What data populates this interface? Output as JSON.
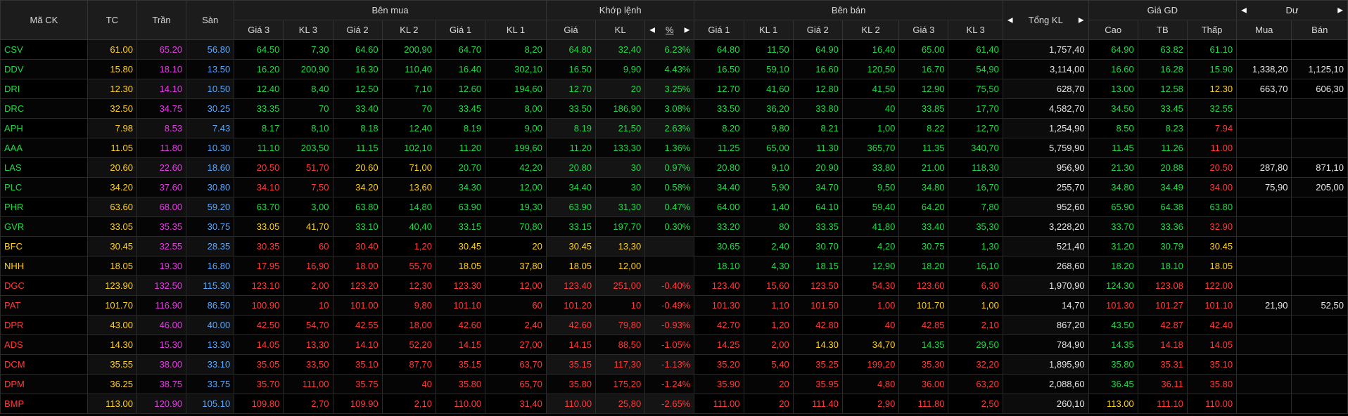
{
  "headers": {
    "symbol": "Mã CK",
    "ref": "TC",
    "ceil": "Trần",
    "floor": "Sàn",
    "buy_group": "Bên mua",
    "match_group": "Khớp lệnh",
    "sell_group": "Bên bán",
    "total": "Tổng KL",
    "price_group": "Giá GD",
    "foreign_group": "Dư",
    "buy_cols": [
      "Giá 3",
      "KL 3",
      "Giá 2",
      "KL 2",
      "Giá 1",
      "KL 1"
    ],
    "match_cols": [
      "Giá",
      "KL",
      "%"
    ],
    "sell_cols": [
      "Giá 1",
      "KL 1",
      "Giá 2",
      "KL 2",
      "Giá 3",
      "KL 3"
    ],
    "price_cols": [
      "Cao",
      "TB",
      "Thấp"
    ],
    "foreign_cols": [
      "Mua",
      "Bán"
    ]
  },
  "colors": {
    "up": "#23d84a",
    "down": "#ff3b3b",
    "ref": "#ffd21f",
    "ceil": "#e63ce6",
    "floor": "#5aa9ff"
  },
  "rows": [
    {
      "sym": "CSV",
      "sc": "up",
      "tc": "61.00",
      "tr": "65.20",
      "sa": "56.80",
      "b3p": "64.50",
      "b3pc": "up",
      "b3v": "7,30",
      "b2p": "64.60",
      "b2pc": "up",
      "b2v": "200,90",
      "b1p": "64.70",
      "b1pc": "up",
      "b1v": "8,20",
      "mp": "64.80",
      "mc": "up",
      "mv": "32,40",
      "pct": "6.23%",
      "s1p": "64.80",
      "s1pc": "up",
      "s1v": "11,50",
      "s2p": "64.90",
      "s2pc": "up",
      "s2v": "16,40",
      "s3p": "65.00",
      "s3pc": "up",
      "s3v": "61,40",
      "tot": "1,757,40",
      "hi": "64.90",
      "hic": "up",
      "avg": "63.82",
      "avgc": "up",
      "lo": "61.10",
      "loc": "up",
      "fb": "",
      "fs": ""
    },
    {
      "sym": "DDV",
      "sc": "up",
      "tc": "15.80",
      "tr": "18.10",
      "sa": "13.50",
      "b3p": "16.20",
      "b3pc": "up",
      "b3v": "200,90",
      "b2p": "16.30",
      "b2pc": "up",
      "b2v": "110,40",
      "b1p": "16.40",
      "b1pc": "up",
      "b1v": "302,10",
      "mp": "16.50",
      "mc": "up",
      "mv": "9,90",
      "pct": "4.43%",
      "s1p": "16.50",
      "s1pc": "up",
      "s1v": "59,10",
      "s2p": "16.60",
      "s2pc": "up",
      "s2v": "120,50",
      "s3p": "16.70",
      "s3pc": "up",
      "s3v": "54,90",
      "tot": "3,114,00",
      "hi": "16.60",
      "hic": "up",
      "avg": "16.28",
      "avgc": "up",
      "lo": "15.90",
      "loc": "up",
      "fb": "1,338,20",
      "fs": "1,125,10"
    },
    {
      "sym": "DRI",
      "sc": "up",
      "tc": "12.30",
      "tr": "14.10",
      "sa": "10.50",
      "b3p": "12.40",
      "b3pc": "up",
      "b3v": "8,40",
      "b2p": "12.50",
      "b2pc": "up",
      "b2v": "7,10",
      "b1p": "12.60",
      "b1pc": "up",
      "b1v": "194,60",
      "mp": "12.70",
      "mc": "up",
      "mv": "20",
      "pct": "3.25%",
      "s1p": "12.70",
      "s1pc": "up",
      "s1v": "41,60",
      "s2p": "12.80",
      "s2pc": "up",
      "s2v": "41,50",
      "s3p": "12.90",
      "s3pc": "up",
      "s3v": "75,50",
      "tot": "628,70",
      "hi": "13.00",
      "hic": "up",
      "avg": "12.58",
      "avgc": "up",
      "lo": "12.30",
      "loc": "ref",
      "fb": "663,70",
      "fs": "606,30"
    },
    {
      "sym": "DRC",
      "sc": "up",
      "tc": "32.50",
      "tr": "34.75",
      "sa": "30.25",
      "b3p": "33.35",
      "b3pc": "up",
      "b3v": "70",
      "b2p": "33.40",
      "b2pc": "up",
      "b2v": "70",
      "b1p": "33.45",
      "b1pc": "up",
      "b1v": "8,00",
      "mp": "33.50",
      "mc": "up",
      "mv": "186,90",
      "pct": "3.08%",
      "s1p": "33.50",
      "s1pc": "up",
      "s1v": "36,20",
      "s2p": "33.80",
      "s2pc": "up",
      "s2v": "40",
      "s3p": "33.85",
      "s3pc": "up",
      "s3v": "17,70",
      "tot": "4,582,70",
      "hi": "34.50",
      "hic": "up",
      "avg": "33.45",
      "avgc": "up",
      "lo": "32.55",
      "loc": "up",
      "fb": "",
      "fs": ""
    },
    {
      "sym": "APH",
      "sc": "up",
      "tc": "7.98",
      "tr": "8.53",
      "sa": "7.43",
      "b3p": "8.17",
      "b3pc": "up",
      "b3v": "8,10",
      "b2p": "8.18",
      "b2pc": "up",
      "b2v": "12,40",
      "b1p": "8.19",
      "b1pc": "up",
      "b1v": "9,00",
      "mp": "8.19",
      "mc": "up",
      "mv": "21,50",
      "pct": "2.63%",
      "s1p": "8.20",
      "s1pc": "up",
      "s1v": "9,80",
      "s2p": "8.21",
      "s2pc": "up",
      "s2v": "1,00",
      "s3p": "8.22",
      "s3pc": "up",
      "s3v": "12,70",
      "tot": "1,254,90",
      "hi": "8.50",
      "hic": "up",
      "avg": "8.23",
      "avgc": "up",
      "lo": "7.94",
      "loc": "down",
      "fb": "",
      "fs": ""
    },
    {
      "sym": "AAA",
      "sc": "up",
      "tc": "11.05",
      "tr": "11.80",
      "sa": "10.30",
      "b3p": "11.10",
      "b3pc": "up",
      "b3v": "203,50",
      "b2p": "11.15",
      "b2pc": "up",
      "b2v": "102,10",
      "b1p": "11.20",
      "b1pc": "up",
      "b1v": "199,60",
      "mp": "11.20",
      "mc": "up",
      "mv": "133,30",
      "pct": "1.36%",
      "s1p": "11.25",
      "s1pc": "up",
      "s1v": "65,00",
      "s2p": "11.30",
      "s2pc": "up",
      "s2v": "365,70",
      "s3p": "11.35",
      "s3pc": "up",
      "s3v": "340,70",
      "tot": "5,759,90",
      "hi": "11.45",
      "hic": "up",
      "avg": "11.26",
      "avgc": "up",
      "lo": "11.00",
      "loc": "down",
      "fb": "",
      "fs": ""
    },
    {
      "sym": "LAS",
      "sc": "up",
      "tc": "20.60",
      "tr": "22.60",
      "sa": "18.60",
      "b3p": "20.50",
      "b3pc": "down",
      "b3v": "51,70",
      "b2p": "20.60",
      "b2pc": "ref",
      "b2v": "71,00",
      "b1p": "20.70",
      "b1pc": "up",
      "b1v": "42,20",
      "mp": "20.80",
      "mc": "up",
      "mv": "30",
      "pct": "0.97%",
      "s1p": "20.80",
      "s1pc": "up",
      "s1v": "9,10",
      "s2p": "20.90",
      "s2pc": "up",
      "s2v": "33,80",
      "s3p": "21.00",
      "s3pc": "up",
      "s3v": "118,30",
      "tot": "956,90",
      "hi": "21.30",
      "hic": "up",
      "avg": "20.88",
      "avgc": "up",
      "lo": "20.50",
      "loc": "down",
      "fb": "287,80",
      "fs": "871,10"
    },
    {
      "sym": "PLC",
      "sc": "up",
      "tc": "34.20",
      "tr": "37.60",
      "sa": "30.80",
      "b3p": "34.10",
      "b3pc": "down",
      "b3v": "7,50",
      "b2p": "34.20",
      "b2pc": "ref",
      "b2v": "13,60",
      "b1p": "34.30",
      "b1pc": "up",
      "b1v": "12,00",
      "mp": "34.40",
      "mc": "up",
      "mv": "30",
      "pct": "0.58%",
      "s1p": "34.40",
      "s1pc": "up",
      "s1v": "5,90",
      "s2p": "34.70",
      "s2pc": "up",
      "s2v": "9,50",
      "s3p": "34.80",
      "s3pc": "up",
      "s3v": "16,70",
      "tot": "255,70",
      "hi": "34.80",
      "hic": "up",
      "avg": "34.49",
      "avgc": "up",
      "lo": "34.00",
      "loc": "down",
      "fb": "75,90",
      "fs": "205,00"
    },
    {
      "sym": "PHR",
      "sc": "up",
      "tc": "63.60",
      "tr": "68.00",
      "sa": "59.20",
      "b3p": "63.70",
      "b3pc": "up",
      "b3v": "3,00",
      "b2p": "63.80",
      "b2pc": "up",
      "b2v": "14,80",
      "b1p": "63.90",
      "b1pc": "up",
      "b1v": "19,30",
      "mp": "63.90",
      "mc": "up",
      "mv": "31,30",
      "pct": "0.47%",
      "s1p": "64.00",
      "s1pc": "up",
      "s1v": "1,40",
      "s2p": "64.10",
      "s2pc": "up",
      "s2v": "59,40",
      "s3p": "64.20",
      "s3pc": "up",
      "s3v": "7,80",
      "tot": "952,60",
      "hi": "65.90",
      "hic": "up",
      "avg": "64.38",
      "avgc": "up",
      "lo": "63.80",
      "loc": "up",
      "fb": "",
      "fs": ""
    },
    {
      "sym": "GVR",
      "sc": "up",
      "tc": "33.05",
      "tr": "35.35",
      "sa": "30.75",
      "b3p": "33.05",
      "b3pc": "ref",
      "b3v": "41,70",
      "b2p": "33.10",
      "b2pc": "up",
      "b2v": "40,40",
      "b1p": "33.15",
      "b1pc": "up",
      "b1v": "70,80",
      "mp": "33.15",
      "mc": "up",
      "mv": "197,70",
      "pct": "0.30%",
      "s1p": "33.20",
      "s1pc": "up",
      "s1v": "80",
      "s2p": "33.35",
      "s2pc": "up",
      "s2v": "41,80",
      "s3p": "33.40",
      "s3pc": "up",
      "s3v": "35,30",
      "tot": "3,228,20",
      "hi": "33.70",
      "hic": "up",
      "avg": "33.36",
      "avgc": "up",
      "lo": "32.90",
      "loc": "down",
      "fb": "",
      "fs": ""
    },
    {
      "sym": "BFC",
      "sc": "ref",
      "tc": "30.45",
      "tr": "32.55",
      "sa": "28.35",
      "b3p": "30.35",
      "b3pc": "down",
      "b3v": "60",
      "b2p": "30.40",
      "b2pc": "down",
      "b2v": "1,20",
      "b1p": "30.45",
      "b1pc": "ref",
      "b1v": "20",
      "mp": "30.45",
      "mc": "ref",
      "mv": "13,30",
      "pct": "",
      "s1p": "30.65",
      "s1pc": "up",
      "s1v": "2,40",
      "s2p": "30.70",
      "s2pc": "up",
      "s2v": "4,20",
      "s3p": "30.75",
      "s3pc": "up",
      "s3v": "1,30",
      "tot": "521,40",
      "hi": "31.20",
      "hic": "up",
      "avg": "30.79",
      "avgc": "up",
      "lo": "30.45",
      "loc": "ref",
      "fb": "",
      "fs": ""
    },
    {
      "sym": "NHH",
      "sc": "ref",
      "tc": "18.05",
      "tr": "19.30",
      "sa": "16.80",
      "b3p": "17.95",
      "b3pc": "down",
      "b3v": "16,90",
      "b2p": "18.00",
      "b2pc": "down",
      "b2v": "55,70",
      "b1p": "18.05",
      "b1pc": "ref",
      "b1v": "37,80",
      "mp": "18.05",
      "mc": "ref",
      "mv": "12,00",
      "pct": "",
      "s1p": "18.10",
      "s1pc": "up",
      "s1v": "4,30",
      "s2p": "18.15",
      "s2pc": "up",
      "s2v": "12,90",
      "s3p": "18.20",
      "s3pc": "up",
      "s3v": "16,10",
      "tot": "268,60",
      "hi": "18.20",
      "hic": "up",
      "avg": "18.10",
      "avgc": "up",
      "lo": "18.05",
      "loc": "ref",
      "fb": "",
      "fs": ""
    },
    {
      "sym": "DGC",
      "sc": "down",
      "tc": "123.90",
      "tr": "132.50",
      "sa": "115.30",
      "b3p": "123.10",
      "b3pc": "down",
      "b3v": "2,00",
      "b2p": "123.20",
      "b2pc": "down",
      "b2v": "12,30",
      "b1p": "123.30",
      "b1pc": "down",
      "b1v": "12,00",
      "mp": "123.40",
      "mc": "down",
      "mv": "251,00",
      "pct": "-0.40%",
      "s1p": "123.40",
      "s1pc": "down",
      "s1v": "15,60",
      "s2p": "123.50",
      "s2pc": "down",
      "s2v": "54,30",
      "s3p": "123.60",
      "s3pc": "down",
      "s3v": "6,30",
      "tot": "1,970,90",
      "hi": "124.30",
      "hic": "up",
      "avg": "123.08",
      "avgc": "down",
      "lo": "122.00",
      "loc": "down",
      "fb": "",
      "fs": ""
    },
    {
      "sym": "PAT",
      "sc": "down",
      "tc": "101.70",
      "tr": "116.90",
      "sa": "86.50",
      "b3p": "100.90",
      "b3pc": "down",
      "b3v": "10",
      "b2p": "101.00",
      "b2pc": "down",
      "b2v": "9,80",
      "b1p": "101.10",
      "b1pc": "down",
      "b1v": "60",
      "mp": "101.20",
      "mc": "down",
      "mv": "10",
      "pct": "-0.49%",
      "s1p": "101.30",
      "s1pc": "down",
      "s1v": "1,10",
      "s2p": "101.50",
      "s2pc": "down",
      "s2v": "1,00",
      "s3p": "101.70",
      "s3pc": "ref",
      "s3v": "1,00",
      "tot": "14,70",
      "hi": "101.30",
      "hic": "down",
      "avg": "101.27",
      "avgc": "down",
      "lo": "101.10",
      "loc": "down",
      "fb": "21,90",
      "fs": "52,50"
    },
    {
      "sym": "DPR",
      "sc": "down",
      "tc": "43.00",
      "tr": "46.00",
      "sa": "40.00",
      "b3p": "42.50",
      "b3pc": "down",
      "b3v": "54,70",
      "b2p": "42.55",
      "b2pc": "down",
      "b2v": "18,00",
      "b1p": "42.60",
      "b1pc": "down",
      "b1v": "2,40",
      "mp": "42.60",
      "mc": "down",
      "mv": "79,80",
      "pct": "-0.93%",
      "s1p": "42.70",
      "s1pc": "down",
      "s1v": "1,20",
      "s2p": "42.80",
      "s2pc": "down",
      "s2v": "40",
      "s3p": "42.85",
      "s3pc": "down",
      "s3v": "2,10",
      "tot": "867,20",
      "hi": "43.50",
      "hic": "up",
      "avg": "42.87",
      "avgc": "down",
      "lo": "42.40",
      "loc": "down",
      "fb": "",
      "fs": ""
    },
    {
      "sym": "ADS",
      "sc": "down",
      "tc": "14.30",
      "tr": "15.30",
      "sa": "13.30",
      "b3p": "14.05",
      "b3pc": "down",
      "b3v": "13,30",
      "b2p": "14.10",
      "b2pc": "down",
      "b2v": "52,20",
      "b1p": "14.15",
      "b1pc": "down",
      "b1v": "27,00",
      "mp": "14.15",
      "mc": "down",
      "mv": "88,50",
      "pct": "-1.05%",
      "s1p": "14.25",
      "s1pc": "down",
      "s1v": "2,00",
      "s2p": "14.30",
      "s2pc": "ref",
      "s2v": "34,70",
      "s3p": "14.35",
      "s3pc": "up",
      "s3v": "29,50",
      "tot": "784,90",
      "hi": "14.35",
      "hic": "up",
      "avg": "14.18",
      "avgc": "down",
      "lo": "14.05",
      "loc": "down",
      "fb": "",
      "fs": ""
    },
    {
      "sym": "DCM",
      "sc": "down",
      "tc": "35.55",
      "tr": "38.00",
      "sa": "33.10",
      "b3p": "35.05",
      "b3pc": "down",
      "b3v": "33,50",
      "b2p": "35.10",
      "b2pc": "down",
      "b2v": "87,70",
      "b1p": "35.15",
      "b1pc": "down",
      "b1v": "63,70",
      "mp": "35.15",
      "mc": "down",
      "mv": "117,30",
      "pct": "-1.13%",
      "s1p": "35.20",
      "s1pc": "down",
      "s1v": "5,40",
      "s2p": "35.25",
      "s2pc": "down",
      "s2v": "199,20",
      "s3p": "35.30",
      "s3pc": "down",
      "s3v": "32,20",
      "tot": "1,895,90",
      "hi": "35.80",
      "hic": "up",
      "avg": "35.31",
      "avgc": "down",
      "lo": "35.10",
      "loc": "down",
      "fb": "",
      "fs": ""
    },
    {
      "sym": "DPM",
      "sc": "down",
      "tc": "36.25",
      "tr": "38.75",
      "sa": "33.75",
      "b3p": "35.70",
      "b3pc": "down",
      "b3v": "111,00",
      "b2p": "35.75",
      "b2pc": "down",
      "b2v": "40",
      "b1p": "35.80",
      "b1pc": "down",
      "b1v": "65,70",
      "mp": "35.80",
      "mc": "down",
      "mv": "175,20",
      "pct": "-1.24%",
      "s1p": "35.90",
      "s1pc": "down",
      "s1v": "20",
      "s2p": "35.95",
      "s2pc": "down",
      "s2v": "4,80",
      "s3p": "36.00",
      "s3pc": "down",
      "s3v": "63,20",
      "tot": "2,088,60",
      "hi": "36.45",
      "hic": "up",
      "avg": "36.11",
      "avgc": "down",
      "lo": "35.80",
      "loc": "down",
      "fb": "",
      "fs": ""
    },
    {
      "sym": "BMP",
      "sc": "down",
      "tc": "113.00",
      "tr": "120.90",
      "sa": "105.10",
      "b3p": "109.80",
      "b3pc": "down",
      "b3v": "2,70",
      "b2p": "109.90",
      "b2pc": "down",
      "b2v": "2,10",
      "b1p": "110.00",
      "b1pc": "down",
      "b1v": "31,40",
      "mp": "110.00",
      "mc": "down",
      "mv": "25,80",
      "pct": "-2.65%",
      "s1p": "111.00",
      "s1pc": "down",
      "s1v": "20",
      "s2p": "111.40",
      "s2pc": "down",
      "s2v": "2,90",
      "s3p": "111.80",
      "s3pc": "down",
      "s3v": "2,50",
      "tot": "260,10",
      "hi": "113.00",
      "hic": "ref",
      "avg": "111.10",
      "avgc": "down",
      "lo": "110.00",
      "loc": "down",
      "fb": "",
      "fs": ""
    }
  ]
}
